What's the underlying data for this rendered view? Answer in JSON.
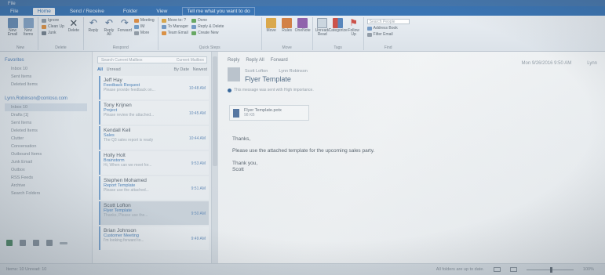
{
  "titlebar": {
    "items": [
      "File",
      "Home",
      "Send / Receive",
      "Folder",
      "View",
      "Tell me what you want to do"
    ]
  },
  "ribbon": {
    "groups": [
      {
        "label": "New",
        "buttons": [
          "New Email",
          "New Items"
        ]
      },
      {
        "label": "Delete",
        "small": [
          "Ignore",
          "Clean Up",
          "Junk"
        ],
        "buttons": [
          "Delete"
        ]
      },
      {
        "label": "Respond",
        "buttons": [
          "Reply",
          "Reply All",
          "Forward"
        ],
        "small": [
          "Meeting",
          "IM",
          "More"
        ]
      },
      {
        "label": "Quick Steps",
        "small": [
          "Move to: ?",
          "To Manager",
          "Team Email",
          "Done",
          "Reply & Delete",
          "Create New"
        ]
      },
      {
        "label": "Move",
        "buttons": [
          "Move",
          "Rules",
          "OneNote"
        ]
      },
      {
        "label": "Tags",
        "buttons": [
          "Unread/ Read",
          "Categorize",
          "Follow Up"
        ]
      },
      {
        "label": "Find",
        "small": [
          "Search People",
          "Address Book",
          "Filter Email"
        ]
      }
    ]
  },
  "nav": {
    "favorites_header": "Favorites",
    "favorites": [
      "Inbox 10",
      "Sent Items",
      "Deleted Items"
    ],
    "account_header": "Lynn.Robinson@contoso.com",
    "folders": [
      "Inbox 10",
      "Drafts [1]",
      "Sent Items",
      "Deleted Items",
      "Clutter",
      "Conversation",
      "Outbound Items",
      "Junk Email",
      "Outbox",
      "RSS Feeds",
      "Archive",
      "Search Folders"
    ],
    "selected_index": 0,
    "footer_icons": [
      "mail-icon",
      "calendar-icon",
      "people-icon",
      "tasks-icon",
      "more-icon"
    ]
  },
  "list": {
    "search_placeholder": "Search Current Mailbox",
    "scope": "Current Mailbox",
    "filter_all": "All",
    "filter_unread": "Unread",
    "sort_by": "By Date",
    "sort_order": "Newest",
    "messages": [
      {
        "from": "Jeff Hay",
        "subject": "Feedback Request",
        "preview": "Please provide feedback on...",
        "time": "10:48 AM",
        "selected": false
      },
      {
        "from": "Tony Krijnen",
        "subject": "Project",
        "preview": "Please review the attached...",
        "time": "10:45 AM",
        "selected": false
      },
      {
        "from": "Kendall Keil",
        "subject": "Sales",
        "preview": "The Q3 sales report is ready",
        "time": "10:44 AM",
        "selected": false
      },
      {
        "from": "Holly Holt",
        "subject": "Brainstorm",
        "preview": "Hi, When can we meet for...",
        "time": "9:53 AM",
        "selected": false
      },
      {
        "from": "Stephen Mohamed",
        "subject": "Report Template",
        "preview": "Please use the attached...",
        "time": "9:51 AM",
        "selected": false
      },
      {
        "from": "Scott Lofton",
        "subject": "Flyer Template",
        "preview": "Thanks, Please use the...",
        "time": "9:50 AM",
        "selected": true
      },
      {
        "from": "Brian Johnson",
        "subject": "Customer Meeting",
        "preview": "I'm looking forward to...",
        "time": "9:49 AM",
        "selected": false
      }
    ]
  },
  "reading": {
    "actions": [
      "Reply",
      "Reply All",
      "Forward"
    ],
    "sender_name": "Scott Lofton",
    "sender_to": "Lynn Robinson",
    "subject": "Flyer Template",
    "info": "This message was sent with High importance.",
    "attachment_name": "Flyer Template.potx",
    "attachment_size": "98 KB",
    "body_greeting": "Thanks,",
    "body_line": "Please use the attached template for the upcoming sales party.",
    "body_signoff": "Thank you,",
    "body_name": "Scott",
    "time_label": "Mon 9/26/2016 9:50 AM",
    "right_label": "Lynn"
  },
  "status": {
    "left": "Items: 10   Unread: 10",
    "right": "All folders are up to date.",
    "zoom": "100%"
  }
}
